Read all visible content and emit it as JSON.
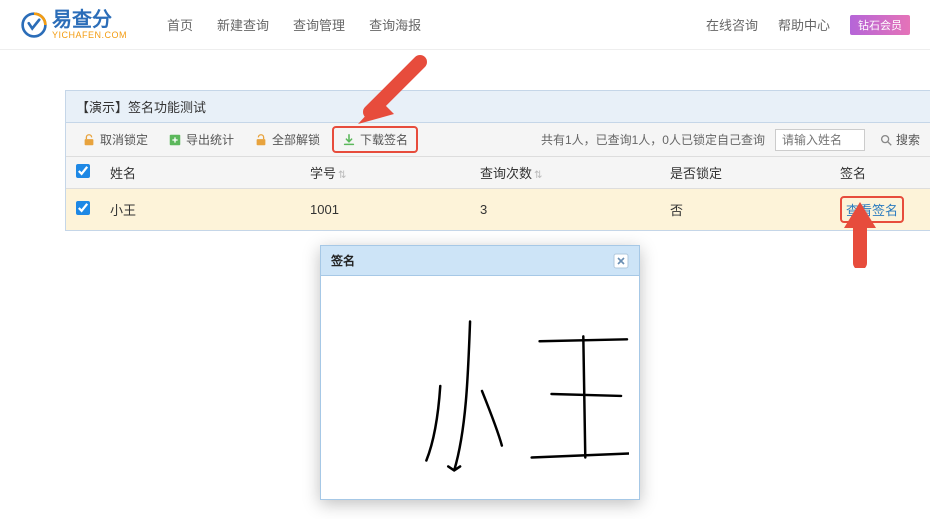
{
  "header": {
    "logo_main": "易查分",
    "logo_sub": "YICHAFEN.COM",
    "nav": {
      "home": "首页",
      "new_query": "新建查询",
      "query_manage": "查询管理",
      "query_poster": "查询海报"
    },
    "right": {
      "online_consult": "在线咨询",
      "help_center": "帮助中心",
      "diamond": "钻石会员"
    }
  },
  "panel": {
    "title": "【演示】签名功能测试",
    "toolbar": {
      "unlock": "取消锁定",
      "export_stats": "导出统计",
      "unlock_all": "全部解锁",
      "download_sig": "下载签名",
      "status": "共有1人，已查询1人，0人已锁定自己查询",
      "search_placeholder": "请输入姓名",
      "search_btn": "搜索"
    },
    "columns": {
      "name": "姓名",
      "student_id": "学号",
      "query_count": "查询次数",
      "locked": "是否锁定",
      "signature": "签名"
    },
    "row": {
      "name": "小王",
      "student_id": "1001",
      "query_count": "3",
      "locked": "否",
      "view_sig": "查看签名"
    }
  },
  "modal": {
    "title": "签名"
  }
}
